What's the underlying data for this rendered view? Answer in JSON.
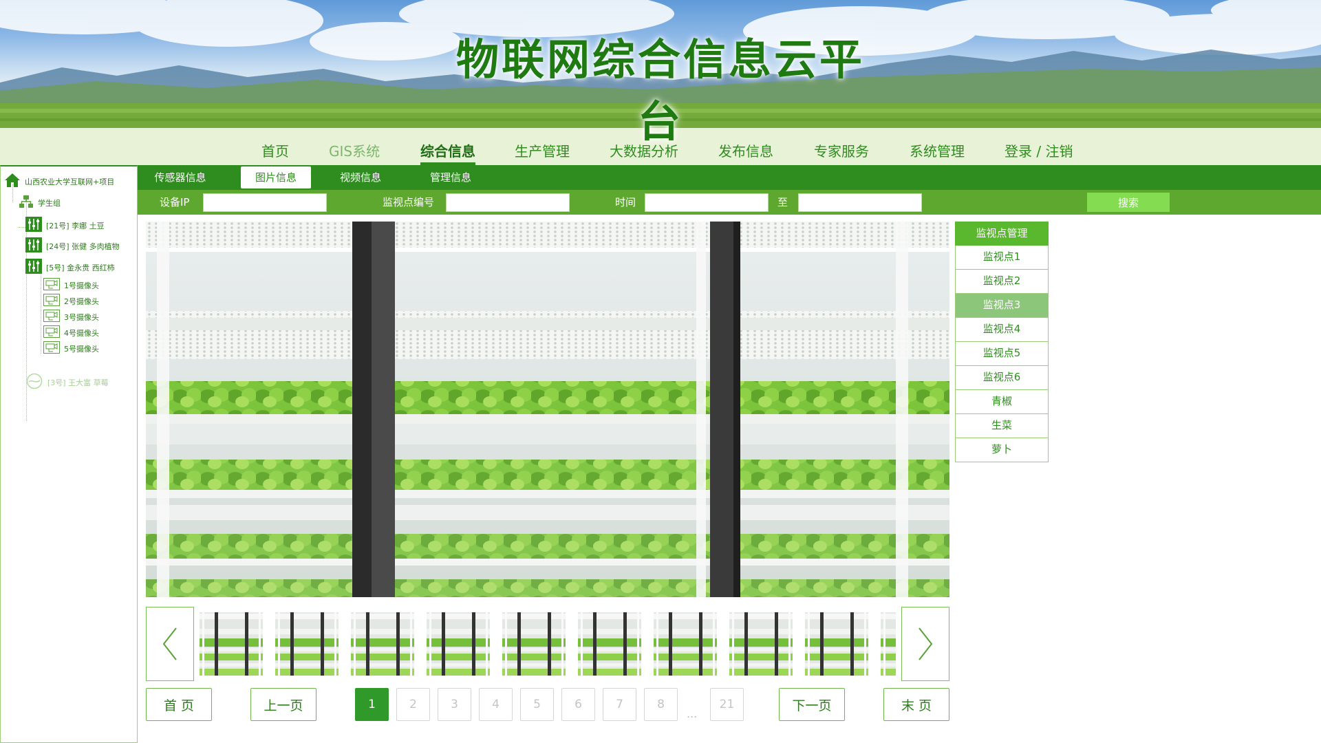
{
  "site": {
    "title": "物联网综合信息云平台"
  },
  "nav": {
    "items": [
      {
        "label": "首页"
      },
      {
        "label": "GIS系统"
      },
      {
        "label": "综合信息"
      },
      {
        "label": "生产管理"
      },
      {
        "label": "大数据分析"
      },
      {
        "label": "发布信息"
      },
      {
        "label": "专家服务"
      },
      {
        "label": "系统管理"
      },
      {
        "label": "登录 / 注销"
      }
    ],
    "active": "综合信息"
  },
  "sidebar": {
    "root": "山西农业大学互联网+项目",
    "group": "学生组",
    "devices": [
      {
        "label": "[21号] 李娜 土豆"
      },
      {
        "label": "[24号] 张健 多肉植物"
      },
      {
        "label": "[5号] 金永贵 西红柿"
      }
    ],
    "cameras": [
      {
        "label": "1号摄像头"
      },
      {
        "label": "2号摄像头"
      },
      {
        "label": "3号摄像头"
      },
      {
        "label": "4号摄像头"
      },
      {
        "label": "5号摄像头"
      }
    ],
    "inactive": {
      "label": "[3号] 王大富 草莓"
    }
  },
  "subnav": {
    "tabs": [
      {
        "label": "传感器信息"
      },
      {
        "label": "图片信息"
      },
      {
        "label": "视频信息"
      },
      {
        "label": "管理信息"
      }
    ],
    "active": "图片信息"
  },
  "filter": {
    "device_ip_label": "设备IP",
    "device_ip_value": "",
    "monitor_no_label": "监视点编号",
    "monitor_no_value": "",
    "time_label": "时间",
    "time_from": "",
    "time_to_label": "至",
    "time_to": "",
    "search_label": "搜索"
  },
  "monitor_list": {
    "header": "监视点管理",
    "items": [
      {
        "label": "监视点1"
      },
      {
        "label": "监视点2"
      },
      {
        "label": "监视点3"
      },
      {
        "label": "监视点4"
      },
      {
        "label": "监视点5"
      },
      {
        "label": "监视点6"
      },
      {
        "label": "青椒"
      },
      {
        "label": "生菜"
      },
      {
        "label": "萝卜"
      }
    ],
    "selected": "监视点3"
  },
  "pagination": {
    "first": "首 页",
    "prev": "上一页",
    "pages": [
      "1",
      "2",
      "3",
      "4",
      "5",
      "6",
      "7",
      "8"
    ],
    "ellipsis": "...",
    "last_page": "21",
    "next": "下一页",
    "last": "末 页",
    "current": "1"
  },
  "colors": {
    "primary_green": "#2f8c1f",
    "light_green": "#5ea82f",
    "accent": "#84dd50",
    "title_green": "#1f7a12"
  },
  "icons": {
    "home": "home-icon",
    "group": "org-chart-icon",
    "device": "sensor-panel-icon",
    "camera": "camera-icon",
    "offline": "offline-device-icon",
    "prev": "chevron-left-icon",
    "next": "chevron-right-icon"
  }
}
